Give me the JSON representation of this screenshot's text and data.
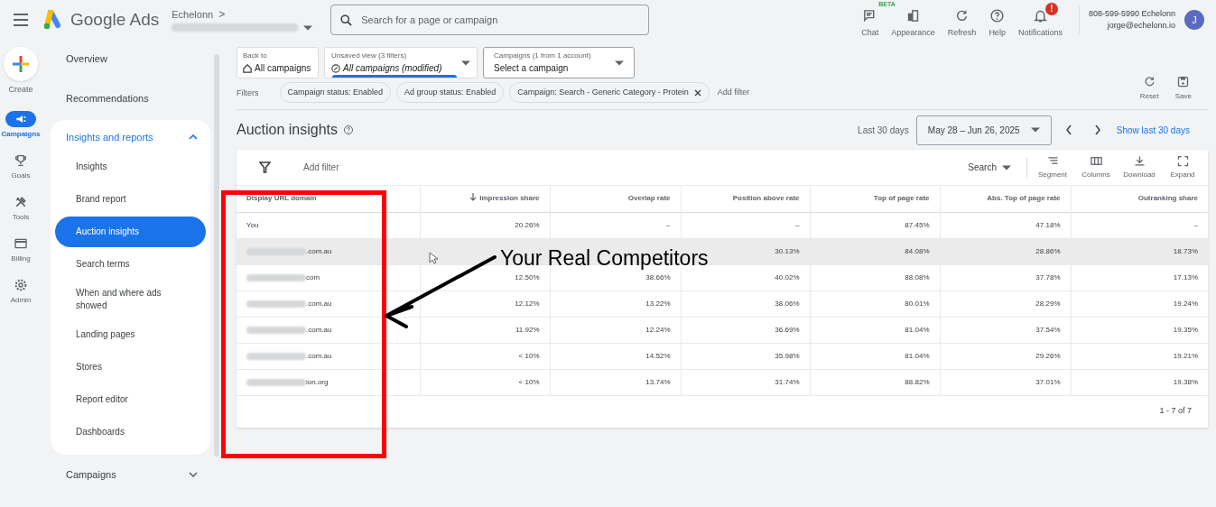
{
  "header": {
    "product": "Google Ads",
    "breadcrumb": "Echelonn",
    "breadcrumb_sep": ">",
    "search": {
      "placeholder": "Search for a page or campaign"
    },
    "actions": [
      {
        "kind": "chat",
        "label": "Chat",
        "badge": "BETA"
      },
      {
        "kind": "appearance",
        "label": "Appearance"
      },
      {
        "kind": "refresh",
        "label": "Refresh"
      },
      {
        "kind": "help",
        "label": "Help"
      },
      {
        "kind": "bell",
        "label": "Notifications",
        "badge": "!"
      }
    ],
    "account": {
      "line1": "808-599-5990 Echelonn",
      "line2": "jorge@echelonn.io",
      "initial": "J"
    }
  },
  "rail": [
    {
      "kind": "create",
      "label": "Create",
      "selected": false
    },
    {
      "kind": "campaigns",
      "label": "Campaigns",
      "selected": true
    },
    {
      "kind": "goals",
      "label": "Goals",
      "selected": false
    },
    {
      "kind": "tools",
      "label": "Tools",
      "selected": false
    },
    {
      "kind": "billing",
      "label": "Billing",
      "selected": false
    },
    {
      "kind": "admin",
      "label": "Admin",
      "selected": false
    }
  ],
  "nav": {
    "top": [
      "Overview",
      "Recommendations"
    ],
    "section": {
      "label": "Insights and reports",
      "expanded": true,
      "items": [
        {
          "label": "Insights",
          "selected": false
        },
        {
          "label": "Brand report",
          "selected": false
        },
        {
          "label": "Auction insights",
          "selected": true
        },
        {
          "label": "Search terms",
          "selected": false
        },
        {
          "label": "When and where ads showed",
          "selected": false
        },
        {
          "label": "Landing pages",
          "selected": false
        },
        {
          "label": "Stores",
          "selected": false
        },
        {
          "label": "Report editor",
          "selected": false
        },
        {
          "label": "Dashboards",
          "selected": false
        }
      ]
    },
    "after": [
      {
        "label": "Campaigns",
        "expanded": false
      }
    ]
  },
  "view_bar": {
    "back": {
      "caption": "Back to",
      "value": "All campaigns"
    },
    "view": {
      "caption": "Unsaved view (3 filters)",
      "value": "All campaigns (modified)"
    },
    "campaign": {
      "caption": "Campaigns (1 from 1 account)",
      "value": "Select a campaign"
    }
  },
  "filters": {
    "label": "Filters",
    "chips": [
      {
        "label": "Campaign status: Enabled",
        "removable": false
      },
      {
        "label": "Ad group status: Enabled",
        "removable": false
      },
      {
        "label": "Campaign: Search - Generic Category - Protein",
        "removable": true
      }
    ],
    "add": "Add filter",
    "actions": [
      {
        "kind": "reset",
        "label": "Reset"
      },
      {
        "kind": "save",
        "label": "Save"
      }
    ]
  },
  "page_title": "Auction insights",
  "date": {
    "label": "Last 30 days",
    "range": "May 28 – Jun 26, 2025",
    "link": "Show last 30 days"
  },
  "table": {
    "add_filter": "Add filter",
    "network": "Search",
    "tools": [
      {
        "kind": "segment",
        "label": "Segment"
      },
      {
        "kind": "columns",
        "label": "Columns"
      },
      {
        "kind": "download",
        "label": "Download"
      },
      {
        "kind": "expand",
        "label": "Expand"
      }
    ],
    "columns": [
      {
        "label": "Display URL domain",
        "sorted": false
      },
      {
        "label": "Impression share",
        "sorted": true
      },
      {
        "label": "Overlap rate",
        "sorted": false
      },
      {
        "label": "Position above rate",
        "sorted": false
      },
      {
        "label": "Top of page rate",
        "sorted": false
      },
      {
        "label": "Abs. Top of page rate",
        "sorted": false
      },
      {
        "label": "Outranking share",
        "sorted": false
      }
    ],
    "rows": [
      {
        "kind": "you",
        "hovered": false,
        "cells": [
          "You",
          "20.26%",
          "–",
          "–",
          "87.45%",
          "47.18%",
          "–"
        ]
      },
      {
        "kind": "redacted",
        "hovered": true,
        "cells": [
          ".com.au",
          "",
          "",
          "30.13%",
          "84.08%",
          "28.86%",
          "18.73%"
        ]
      },
      {
        "kind": "redacted",
        "hovered": false,
        "cells": [
          "com",
          "12.50%",
          "38.66%",
          "40.02%",
          "88.08%",
          "37.78%",
          "17.13%"
        ]
      },
      {
        "kind": "redacted",
        "hovered": false,
        "cells": [
          ".com.au",
          "12.12%",
          "13.22%",
          "38.06%",
          "80.01%",
          "28.29%",
          "19.24%"
        ]
      },
      {
        "kind": "redacted",
        "hovered": false,
        "cells": [
          ".com.au",
          "11.92%",
          "12.24%",
          "36.69%",
          "81.04%",
          "37.54%",
          "19.35%"
        ]
      },
      {
        "kind": "redacted",
        "hovered": false,
        "cells": [
          ".com.au",
          "< 10%",
          "14.52%",
          "35.98%",
          "81.04%",
          "29.26%",
          "19.21%"
        ]
      },
      {
        "kind": "redacted",
        "hovered": false,
        "cells": [
          "ion.org",
          "< 10%",
          "13.74%",
          "31.74%",
          "88.82%",
          "37.01%",
          "19.38%"
        ]
      }
    ],
    "pagination": "1 - 7 of 7"
  },
  "annotation": {
    "text": "Your Real Competitors"
  }
}
